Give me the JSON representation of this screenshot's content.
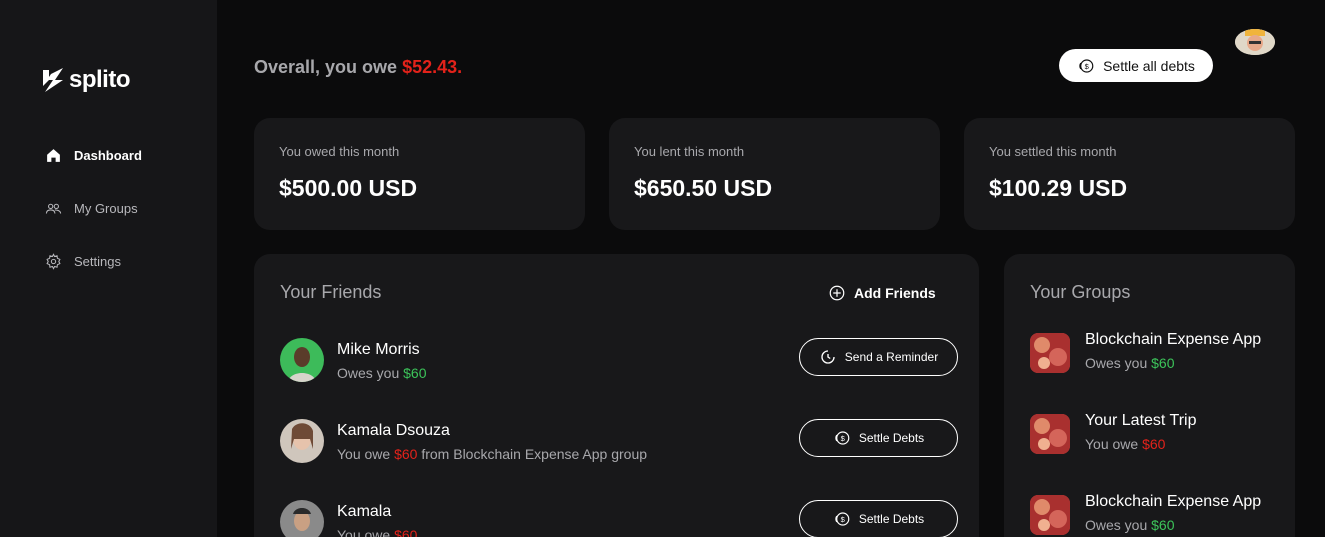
{
  "app": {
    "name": "splito",
    "nav": [
      {
        "label": "Dashboard",
        "icon": "home-icon",
        "active": true
      },
      {
        "label": "My Groups",
        "icon": "users-icon",
        "active": false
      },
      {
        "label": "Settings",
        "icon": "gear-icon",
        "active": false
      }
    ]
  },
  "header": {
    "overall_prefix": "Overall, you owe ",
    "overall_amount": "$52.43.",
    "settle_all_label": "Settle all debts"
  },
  "stats": [
    {
      "label": "You owed this month",
      "value": "$500.00 USD"
    },
    {
      "label": "You lent this month",
      "value": "$650.50 USD"
    },
    {
      "label": "You settled this month",
      "value": "$100.29 USD"
    }
  ],
  "friends": {
    "title": "Your Friends",
    "add_label": "Add Friends",
    "items": [
      {
        "name": "Mike Morris",
        "sub_prefix": "Owes you ",
        "amount": "$60",
        "sub_suffix": "",
        "amount_color": "green",
        "action": "Send a Reminder",
        "action_icon": "clock-icon"
      },
      {
        "name": "Kamala Dsouza",
        "sub_prefix": "You owe ",
        "amount": "$60",
        "sub_suffix": " from Blockchain Expense App group",
        "amount_color": "red",
        "action": "Settle Debts",
        "action_icon": "coins-icon"
      },
      {
        "name": "Kamala",
        "sub_prefix": "You owe ",
        "amount": "$60",
        "sub_suffix": "",
        "amount_color": "red",
        "action": "Settle Debts",
        "action_icon": "coins-icon"
      }
    ]
  },
  "groups": {
    "title": "Your Groups",
    "items": [
      {
        "name": "Blockchain Expense App",
        "sub_prefix": "Owes you ",
        "amount": "$60",
        "amount_color": "green"
      },
      {
        "name": "Your Latest Trip",
        "sub_prefix": "You owe ",
        "amount": "$60",
        "amount_color": "red"
      },
      {
        "name": "Blockchain Expense App",
        "sub_prefix": "Owes you ",
        "amount": "$60",
        "amount_color": "green"
      }
    ]
  },
  "colors": {
    "background": "#0b0b0c",
    "sidebar": "#161618",
    "card": "#18181a",
    "owe_red": "#e3221a",
    "owed_green": "#3cc45a"
  }
}
